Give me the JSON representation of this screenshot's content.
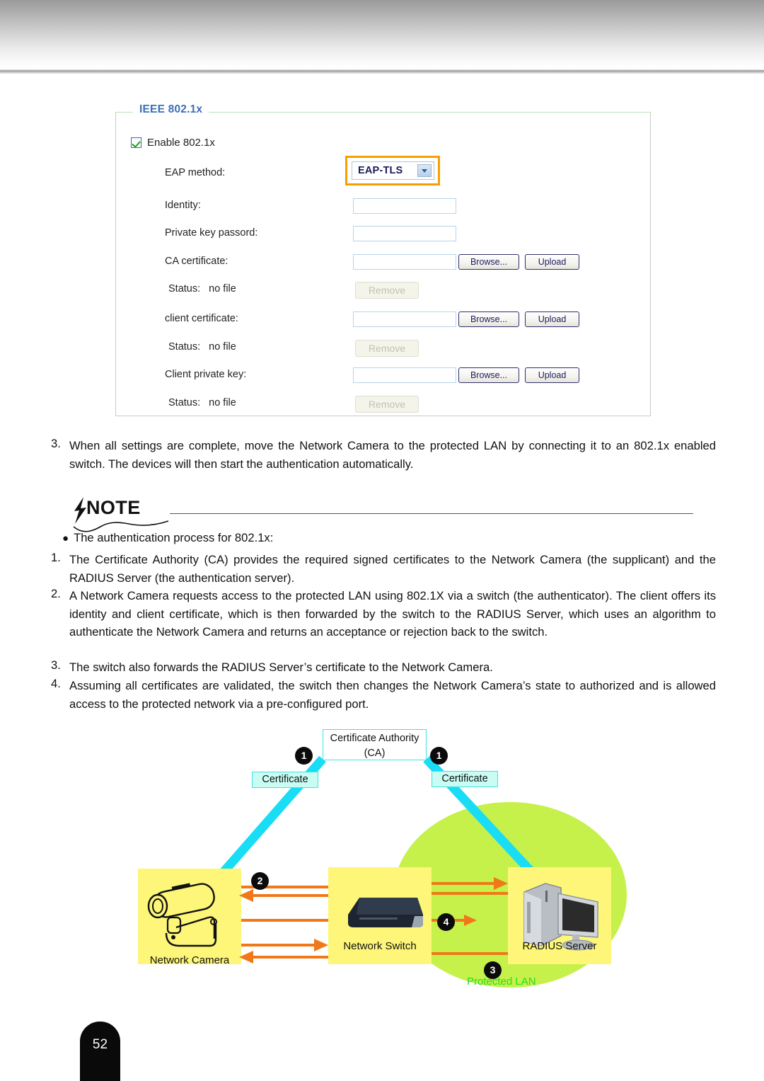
{
  "panel": {
    "legend": "IEEE 802.1x",
    "enable_checkbox_label": "Enable 802.1x",
    "enable_checked": true,
    "rows": [
      {
        "label": "EAP method:",
        "value": "EAP-TLS"
      },
      {
        "label": "Identity:",
        "value": ""
      },
      {
        "label": "Private key passord:",
        "value": ""
      },
      {
        "label": "CA certificate:",
        "value": ""
      },
      {
        "label": "Status:",
        "value": "no file"
      },
      {
        "label": "client certificate:",
        "value": ""
      },
      {
        "label": "Status:",
        "value": "no file"
      },
      {
        "label": "Client private key:",
        "value": ""
      },
      {
        "label": "Status:",
        "value": "no file"
      }
    ],
    "buttons": {
      "browse": "Browse...",
      "upload": "Upload",
      "remove": "Remove"
    },
    "colors": {
      "legend_blue": "#3b6fb6",
      "highlight_orange": "#f5a000",
      "checkbox_green": "#18a018"
    }
  },
  "steps": {
    "step3_num": "3.",
    "step3_text": "When all settings are complete, move the Network Camera to the protected LAN by connecting it to an 802.1x enabled switch. The devices will then start the authentication automatically."
  },
  "note": {
    "heading": "NOTE",
    "bullet": "The authentication process for 802.1x:",
    "items": [
      {
        "num": "1.",
        "text": "The Certificate Authority (CA) provides the required signed certificates to the Network Camera (the supplicant) and the RADIUS Server (the authentication server)."
      },
      {
        "num": "2.",
        "text": "A Network Camera requests access to the protected LAN using 802.1X via a switch (the authenticator).  The client offers its identity and client certificate, which is then forwarded by the switch to the RADIUS Server, which uses an algorithm to authenticate the Network Camera and returns an acceptance or rejection back to the switch."
      },
      {
        "num": "3.",
        "text": "The switch also forwards the RADIUS Server’s certificate to the Network Camera."
      },
      {
        "num": "4.",
        "text": "Assuming all certificates are validated, the switch then changes the Network Camera’s state to authorized and is allowed access to the protected network via a pre-configured port."
      }
    ]
  },
  "diagram": {
    "ca_line1": "Certificate Authority",
    "ca_line2": "(CA)",
    "certificate_left": "Certificate",
    "certificate_right": "Certificate",
    "badges": {
      "b1a": "1",
      "b1b": "1",
      "b2": "2",
      "b3": "3",
      "b4": "4"
    },
    "network_camera": "Network Camera",
    "network_switch": "Network Switch",
    "radius_server": "RADIUS Server",
    "protected_lan": "Protected LAN",
    "colors": {
      "lan_ellipse": "#c6f04a",
      "host_box": "#fdf679",
      "arrow_cyan": "#19dcf5",
      "arrow_orange": "#f07818",
      "lan_label_green": "#22e022",
      "cert_chip": "#c9fcf2"
    }
  },
  "footer": {
    "page_number": "52"
  }
}
